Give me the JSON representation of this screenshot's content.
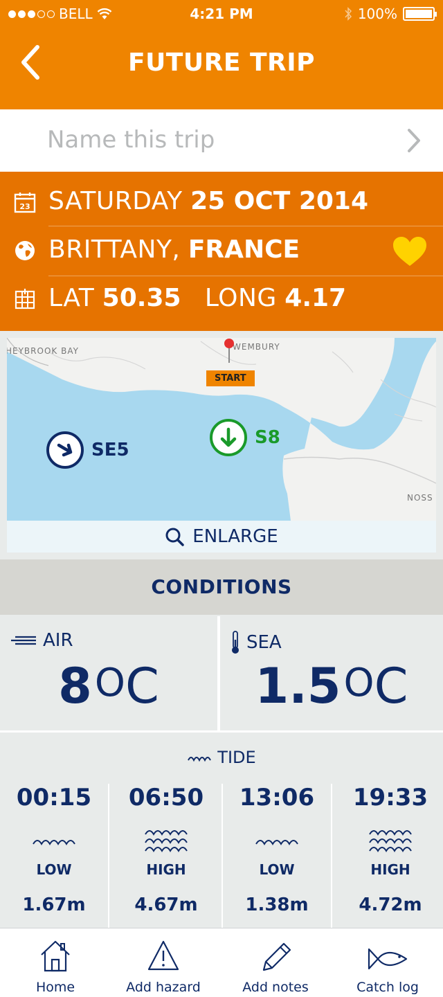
{
  "status_bar": {
    "carrier": "BELL",
    "time": "4:21 PM",
    "battery": "100%"
  },
  "nav": {
    "title": "FUTURE TRIP"
  },
  "name_row": {
    "placeholder": "Name this trip"
  },
  "trip": {
    "day": "SATURDAY",
    "date": "25 OCT 2014",
    "region": "BRITTANY,",
    "country": "FRANCE",
    "lat_label": "LAT",
    "lat": "50.35",
    "long_label": "LONG",
    "long": "4.17"
  },
  "map": {
    "labels": [
      "HEYBROOK BAY",
      "WEMBURY",
      "NOSS"
    ],
    "start_label": "START",
    "wind_se": "SE5",
    "wind_s": "S8",
    "enlarge_label": "ENLARGE"
  },
  "conditions": {
    "title": "CONDITIONS",
    "air_label": "AIR",
    "air_value": "8",
    "sea_label": "SEA",
    "sea_value": "1.5",
    "deg_symbol": "O",
    "unit": "C"
  },
  "tide": {
    "title": "TIDE",
    "entries": [
      {
        "time": "00:15",
        "kind": "LOW",
        "height": "1.67m"
      },
      {
        "time": "06:50",
        "kind": "HIGH",
        "height": "4.67m"
      },
      {
        "time": "13:06",
        "kind": "LOW",
        "height": "1.38m"
      },
      {
        "time": "19:33",
        "kind": "HIGH",
        "height": "4.72m"
      }
    ]
  },
  "tabbar": {
    "items": [
      {
        "label": "Home",
        "icon": "home-icon"
      },
      {
        "label": "Add hazard",
        "icon": "hazard-icon"
      },
      {
        "label": "Add notes",
        "icon": "pencil-icon"
      },
      {
        "label": "Catch log",
        "icon": "fish-icon"
      }
    ]
  },
  "colors": {
    "orange": "#ef8400",
    "dark_orange": "#e67300",
    "navy": "#0f2a66",
    "sea": "#a8d8ef",
    "green": "#1a9a2a",
    "heart": "#ffd200"
  }
}
